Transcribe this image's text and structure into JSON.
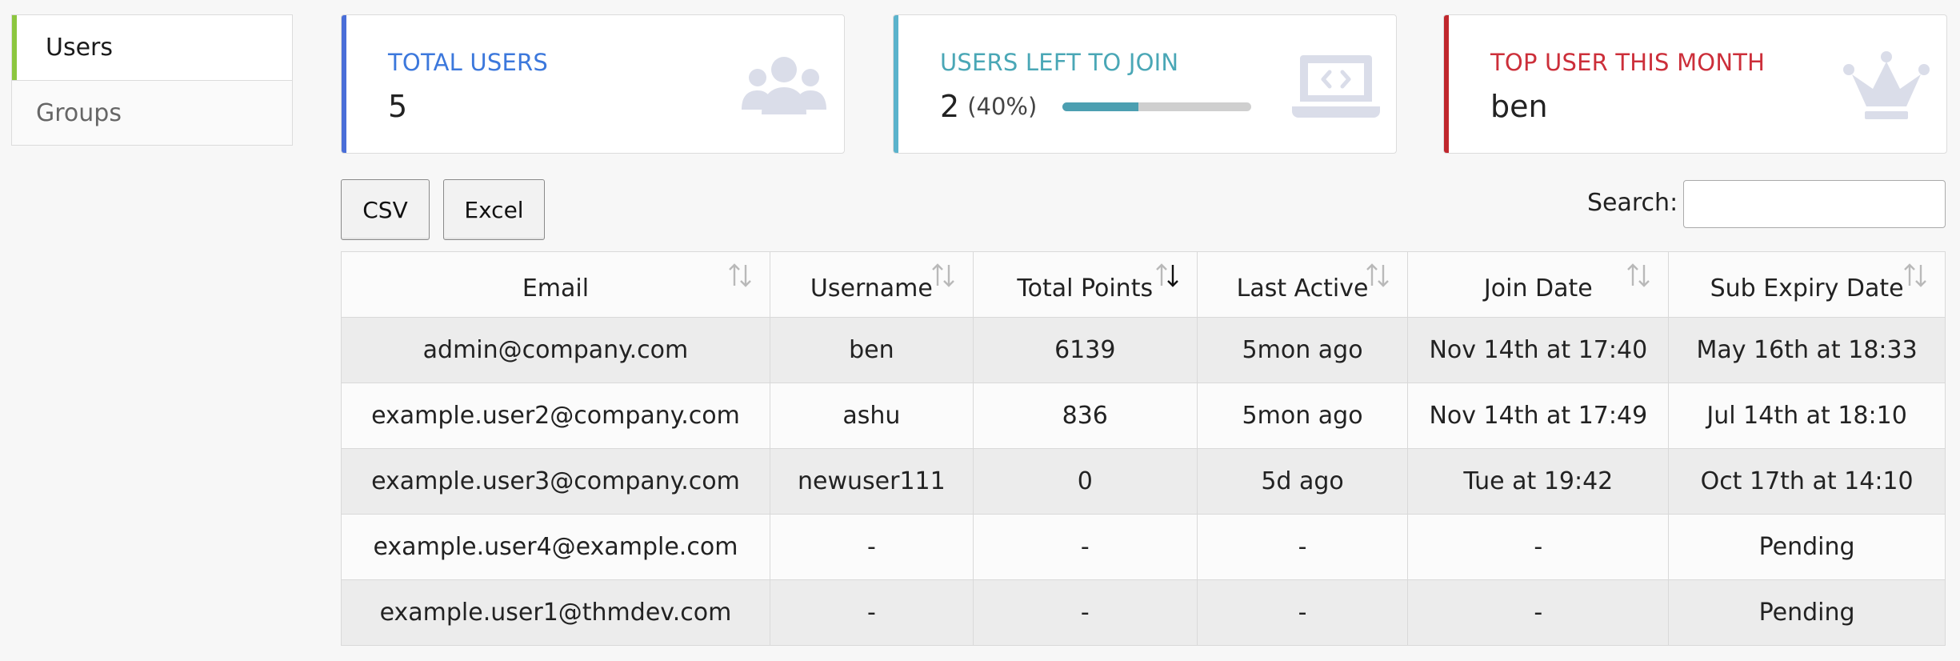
{
  "sidebar": {
    "items": [
      {
        "label": "Users",
        "active": true
      },
      {
        "label": "Groups",
        "active": false
      }
    ]
  },
  "cards": {
    "total_users": {
      "label": "TOTAL USERS",
      "value": "5",
      "icon": "users-group-icon",
      "accent": "#4a6ed8"
    },
    "users_left": {
      "label": "USERS LEFT TO JOIN",
      "value": "2",
      "percent_text": "(40%)",
      "progress": 0.4,
      "icon": "laptop-code-icon",
      "accent": "#5bb3cc"
    },
    "top_user": {
      "label": "TOP USER THIS MONTH",
      "value": "ben",
      "icon": "crown-icon",
      "accent": "#c0272d"
    }
  },
  "toolbar": {
    "csv_label": "CSV",
    "excel_label": "Excel",
    "search_label": "Search:",
    "search_value": ""
  },
  "table": {
    "columns": [
      {
        "label": "Email",
        "sort": "none"
      },
      {
        "label": "Username",
        "sort": "none"
      },
      {
        "label": "Total Points",
        "sort": "desc"
      },
      {
        "label": "Last Active",
        "sort": "none"
      },
      {
        "label": "Join Date",
        "sort": "none"
      },
      {
        "label": "Sub Expiry Date",
        "sort": "none"
      }
    ],
    "rows": [
      [
        "admin@company.com",
        "ben",
        "6139",
        "5mon ago",
        "Nov 14th at 17:40",
        "May 16th at 18:33"
      ],
      [
        "example.user2@company.com",
        "ashu",
        "836",
        "5mon ago",
        "Nov 14th at 17:49",
        "Jul 14th at 18:10"
      ],
      [
        "example.user3@company.com",
        "newuser111",
        "0",
        "5d ago",
        "Tue at 19:42",
        "Oct 17th at 14:10"
      ],
      [
        "example.user4@example.com",
        "-",
        "-",
        "-",
        "-",
        "Pending"
      ],
      [
        "example.user1@thmdev.com",
        "-",
        "-",
        "-",
        "-",
        "Pending"
      ]
    ]
  }
}
